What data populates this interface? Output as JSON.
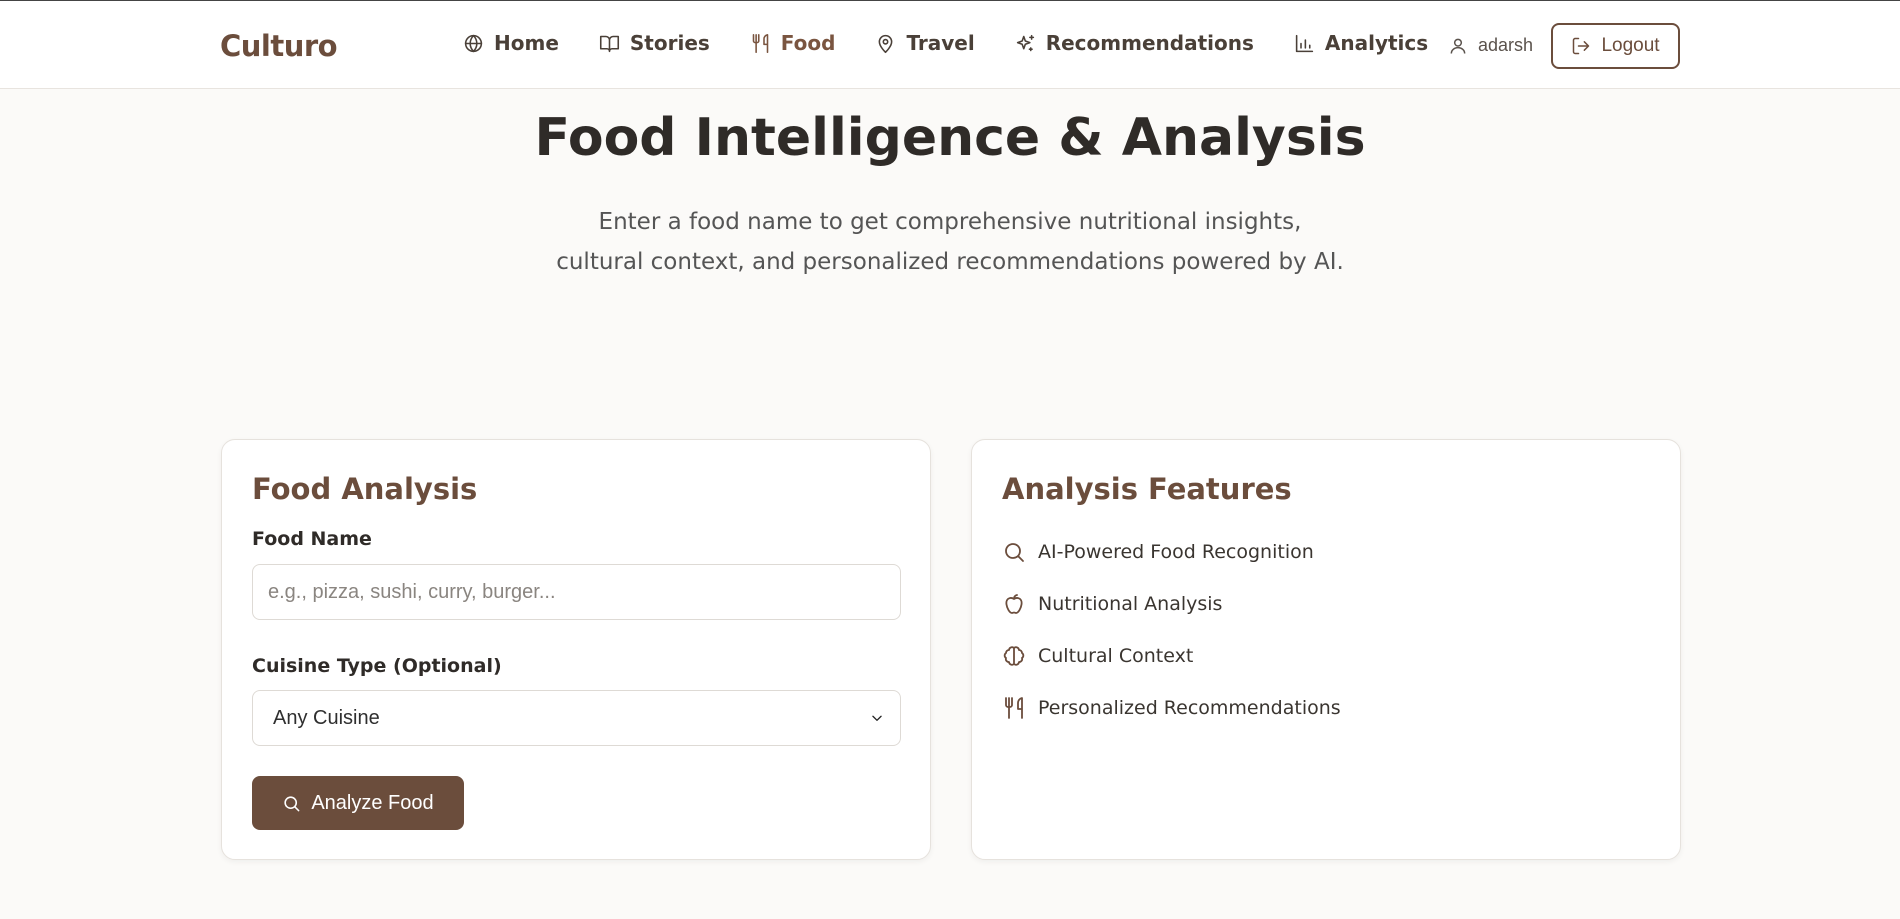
{
  "header": {
    "brand": "Culturo",
    "nav": [
      {
        "label": "Home",
        "icon": "globe-icon",
        "active": false
      },
      {
        "label": "Stories",
        "icon": "book-icon",
        "active": false
      },
      {
        "label": "Food",
        "icon": "utensils-icon",
        "active": true
      },
      {
        "label": "Travel",
        "icon": "map-pin-icon",
        "active": false
      },
      {
        "label": "Recommendations",
        "icon": "sparkles-icon",
        "active": false
      },
      {
        "label": "Analytics",
        "icon": "bar-chart-icon",
        "active": false
      }
    ],
    "username": "adarsh",
    "logout_label": "Logout"
  },
  "hero": {
    "title": "Food Intelligence & Analysis",
    "subtitle_line1": "Enter a food name to get comprehensive nutritional insights,",
    "subtitle_line2": "cultural context, and personalized recommendations powered by AI."
  },
  "form": {
    "title": "Food Analysis",
    "food_label": "Food Name",
    "food_value": "",
    "food_placeholder": "e.g., pizza, sushi, curry, burger...",
    "cuisine_label": "Cuisine Type (Optional)",
    "cuisine_selected": "Any Cuisine",
    "submit_label": "Analyze Food"
  },
  "features": {
    "title": "Analysis Features",
    "items": [
      {
        "label": "AI-Powered Food Recognition",
        "icon": "search-icon"
      },
      {
        "label": "Nutritional Analysis",
        "icon": "apple-icon"
      },
      {
        "label": "Cultural Context",
        "icon": "brain-icon"
      },
      {
        "label": "Personalized Recommendations",
        "icon": "utensils-icon"
      }
    ]
  },
  "colors": {
    "brand": "#6b4d3c",
    "background": "#fbfaf8",
    "card": "#ffffff"
  }
}
